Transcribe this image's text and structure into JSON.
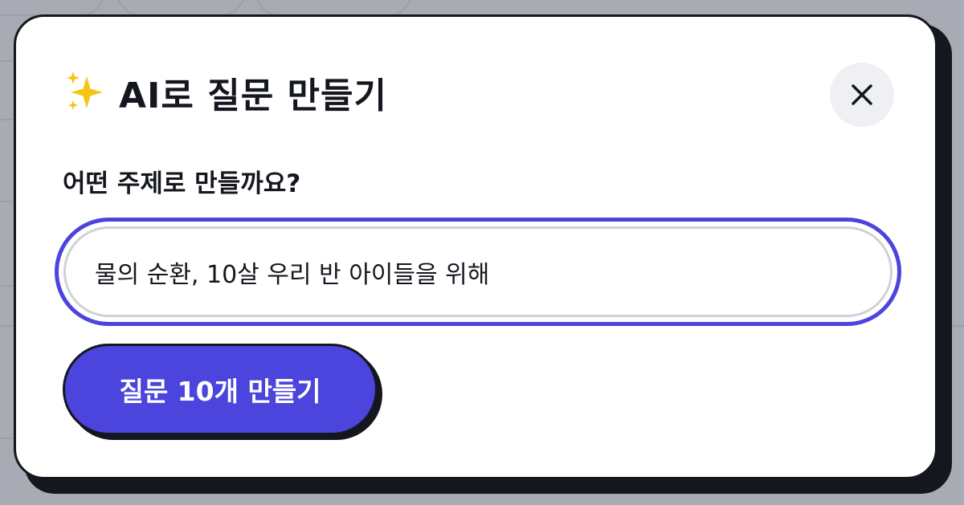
{
  "background": {
    "chips": [
      "...",
      "...",
      "..."
    ],
    "side_glyphs": [
      "...",
      "...",
      "...",
      "..."
    ],
    "bottom_text": "..."
  },
  "modal": {
    "title": "AI로 질문 만들기",
    "title_icon": "sparkles-icon",
    "close_icon": "close-icon",
    "prompt_label": "어떤 주제로 만들까요?",
    "topic_input": {
      "value": "물의 순환, 10살 우리 반 아이들을 위해",
      "placeholder": ""
    },
    "generate_label": "질문 10개 만들기"
  },
  "colors": {
    "accent": "#4b44dd",
    "ink": "#15171f",
    "overlay": "#a9abb4",
    "close_bg": "#eff0f3",
    "sparkle": "#f5c518"
  }
}
